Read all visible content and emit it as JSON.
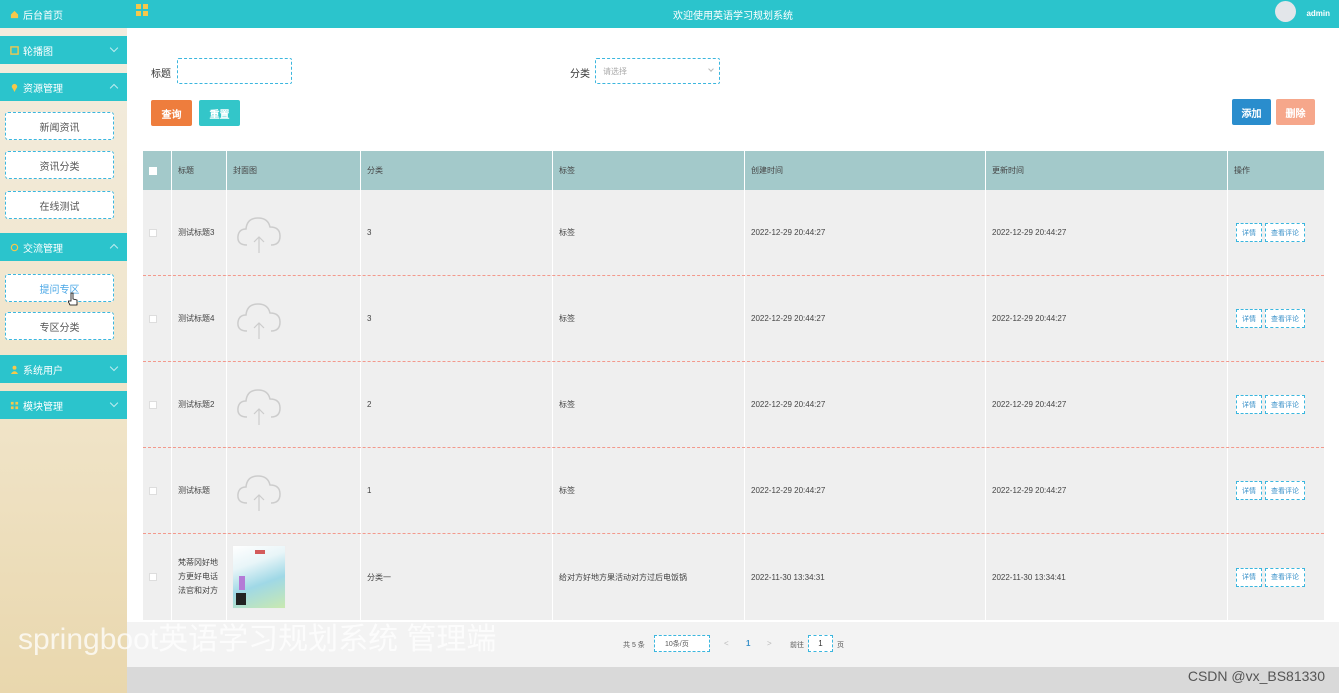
{
  "header": {
    "title": "欢迎使用英语学习规划系统",
    "user": "admin"
  },
  "sidebar": {
    "home": "后台首页",
    "groups": [
      {
        "label": "轮播图"
      },
      {
        "label": "资源管理",
        "items": [
          "新闻资讯",
          "资讯分类",
          "在线测试"
        ]
      },
      {
        "label": "交流管理",
        "items": [
          "提问专区",
          "专区分类"
        ]
      },
      {
        "label": "系统用户"
      },
      {
        "label": "模块管理"
      }
    ],
    "active_item": "提问专区"
  },
  "search": {
    "title_label": "标题",
    "title_value": "",
    "category_label": "分类",
    "category_placeholder": "请选择"
  },
  "buttons": {
    "query": "查询",
    "reset": "重置",
    "add": "添加",
    "delete": "删除"
  },
  "table": {
    "columns": [
      "标题",
      "封面图",
      "分类",
      "标签",
      "创建时间",
      "更新时间",
      "操作"
    ],
    "rows": [
      {
        "title": "测试标题3",
        "cover": "placeholder",
        "category": "3",
        "tag": "标签",
        "created": "2022-12-29 20:44:27",
        "updated": "2022-12-29 20:44:27"
      },
      {
        "title": "测试标题4",
        "cover": "placeholder",
        "category": "3",
        "tag": "标签",
        "created": "2022-12-29 20:44:27",
        "updated": "2022-12-29 20:44:27"
      },
      {
        "title": "测试标题2",
        "cover": "placeholder",
        "category": "2",
        "tag": "标签",
        "created": "2022-12-29 20:44:27",
        "updated": "2022-12-29 20:44:27"
      },
      {
        "title": "测试标题",
        "cover": "placeholder",
        "category": "1",
        "tag": "标签",
        "created": "2022-12-29 20:44:27",
        "updated": "2022-12-29 20:44:27"
      },
      {
        "title": "梵蒂冈好地方更好电话法官和对方",
        "cover": "image",
        "category": "分类一",
        "tag": "给对方好地方果活动对方过后电饭锅",
        "created": "2022-11-30 13:34:31",
        "updated": "2022-11-30 13:34:41"
      }
    ],
    "row_actions": [
      "详情",
      "查看评论"
    ]
  },
  "pagination": {
    "total": "共 5 条",
    "page_size": "10条/页",
    "prev": "<",
    "current": "1",
    "next": ">",
    "goto_label": "前往",
    "goto_value": "1",
    "goto_unit": "页"
  },
  "watermark": "springboot英语学习规划系统 管理端",
  "csdn": "CSDN @vx_BS81330"
}
